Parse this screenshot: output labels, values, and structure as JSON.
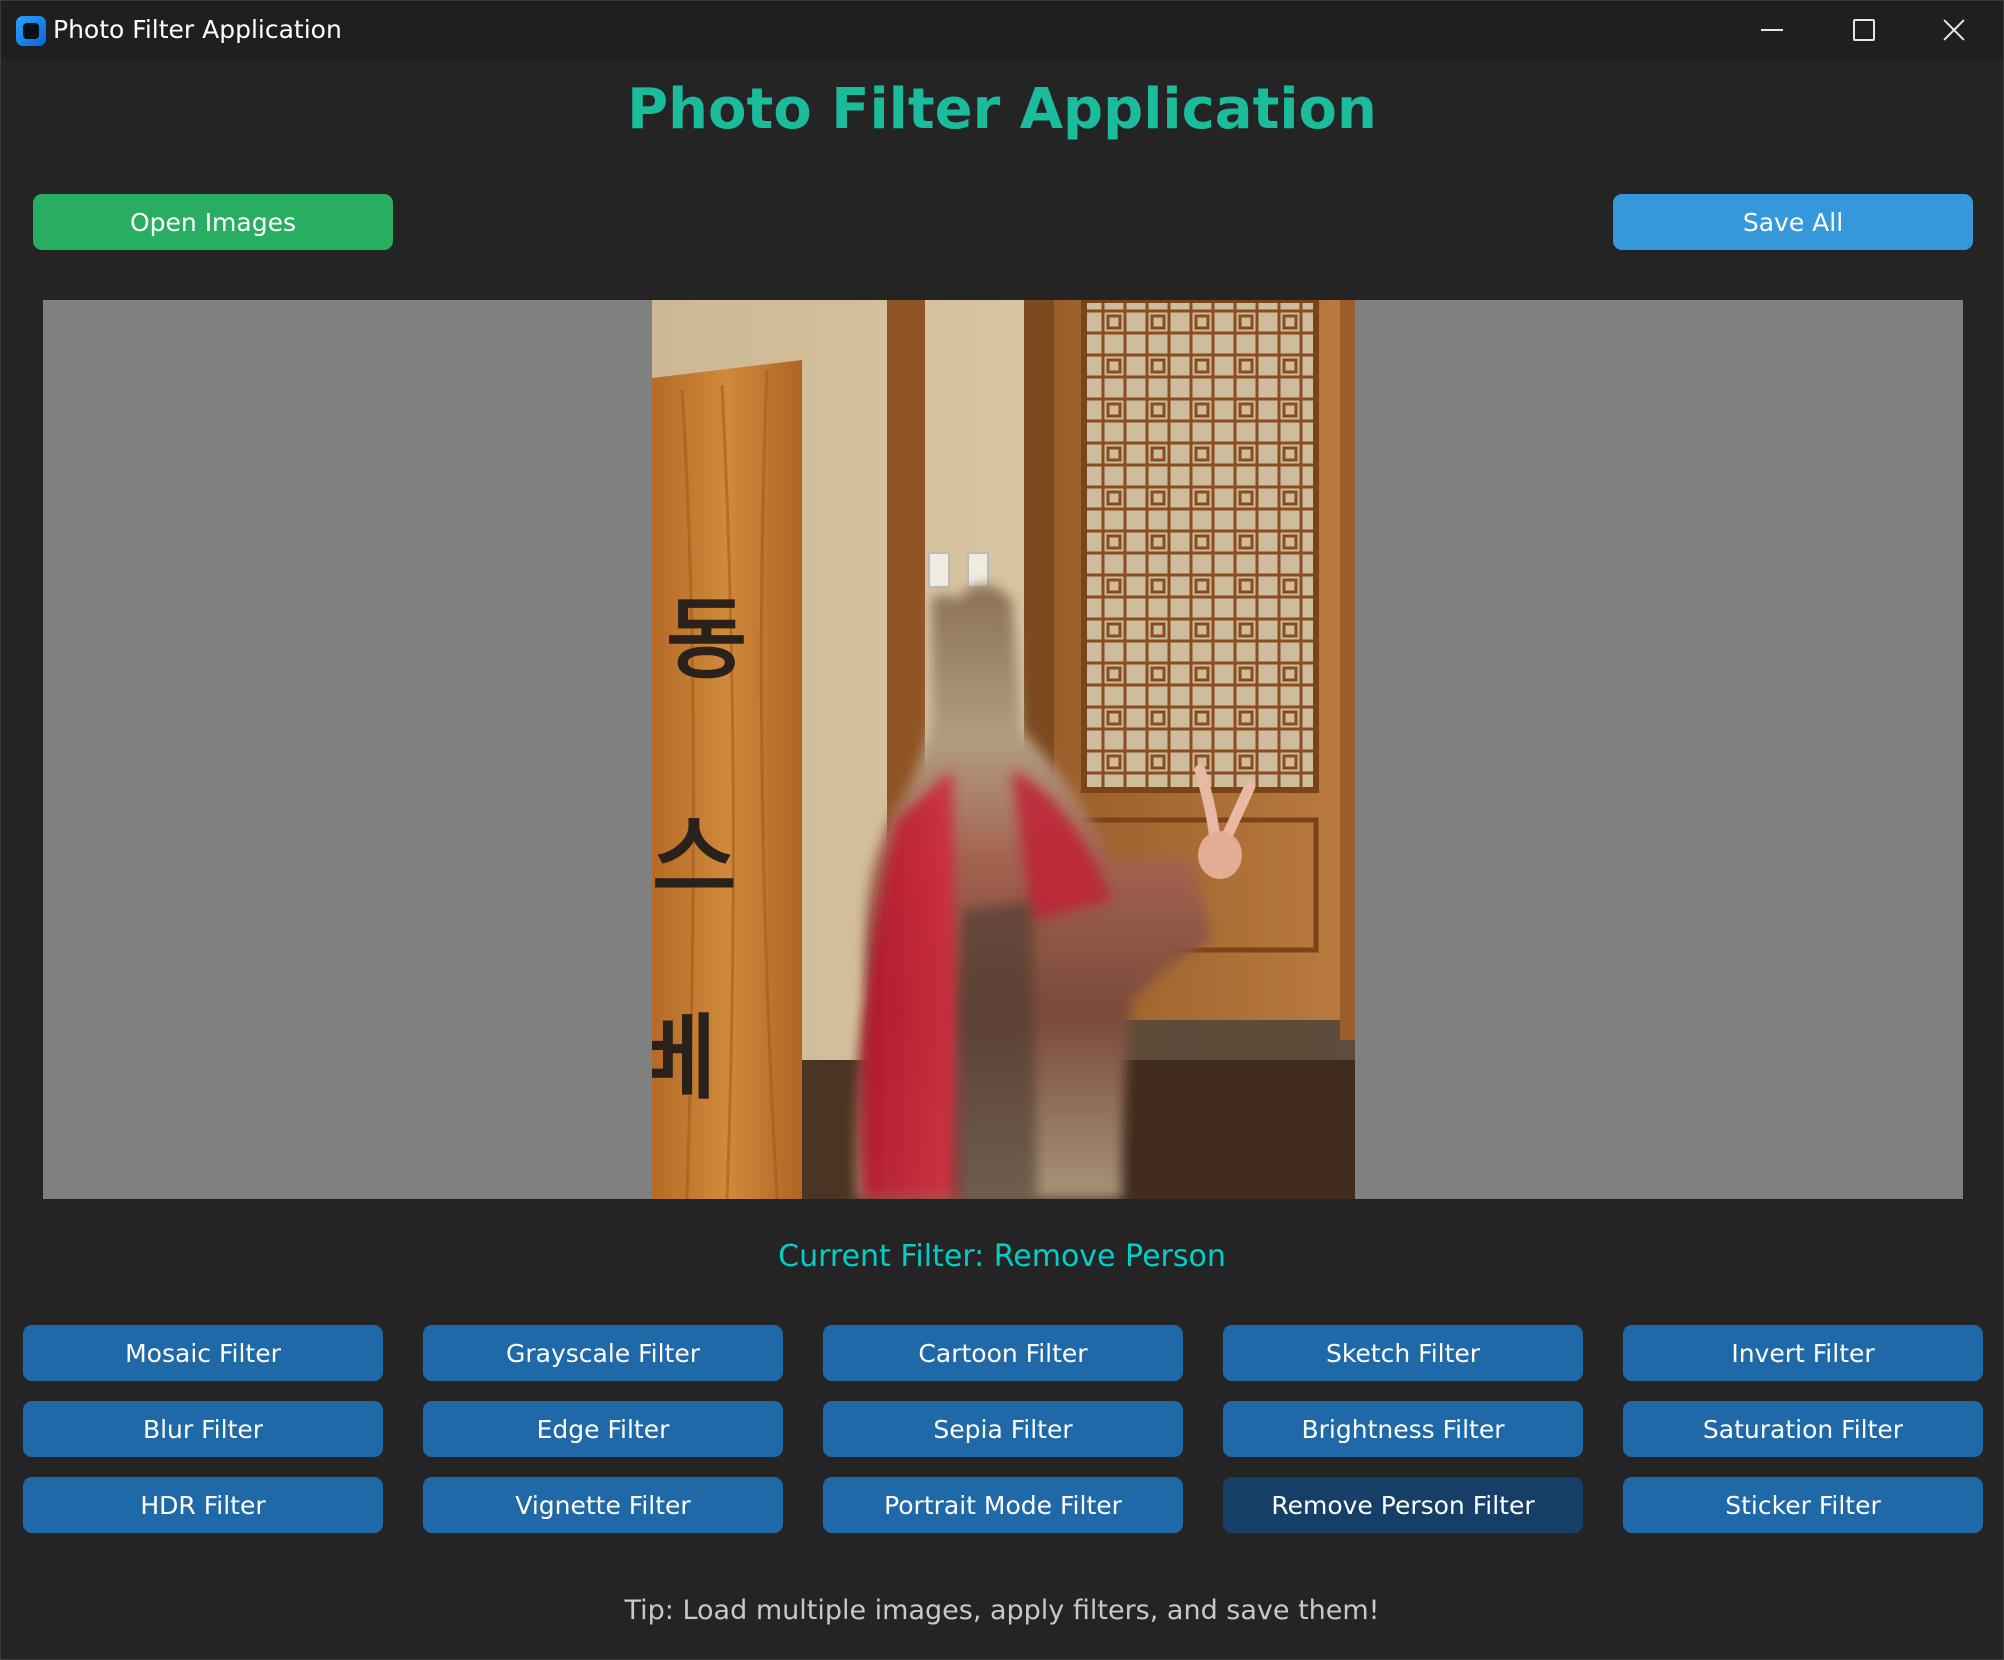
{
  "window": {
    "title": "Photo Filter Application"
  },
  "header": {
    "title": "Photo Filter Application",
    "open_label": "Open Images",
    "save_label": "Save All"
  },
  "preview": {
    "sign_characters": [
      "동",
      "스",
      "베"
    ]
  },
  "status": {
    "current_filter": "Current Filter: Remove Person"
  },
  "filters": [
    {
      "label": "Mosaic Filter"
    },
    {
      "label": "Grayscale Filter"
    },
    {
      "label": "Cartoon Filter"
    },
    {
      "label": "Sketch Filter"
    },
    {
      "label": "Invert Filter"
    },
    {
      "label": "Blur Filter"
    },
    {
      "label": "Edge Filter"
    },
    {
      "label": "Sepia Filter"
    },
    {
      "label": "Brightness Filter"
    },
    {
      "label": "Saturation Filter"
    },
    {
      "label": "HDR Filter"
    },
    {
      "label": "Vignette Filter"
    },
    {
      "label": "Portrait Mode Filter"
    },
    {
      "label": "Remove Person Filter",
      "active": true
    },
    {
      "label": "Sticker Filter"
    }
  ],
  "footer": {
    "tip": "Tip: Load multiple images, apply filters, and save them!"
  },
  "colors": {
    "title": "#1abc9c",
    "open_button": "#27ae60",
    "save_button": "#3498db",
    "filter_button": "#2069a8",
    "filter_button_active": "#163f68",
    "status_text": "#00cec9"
  }
}
